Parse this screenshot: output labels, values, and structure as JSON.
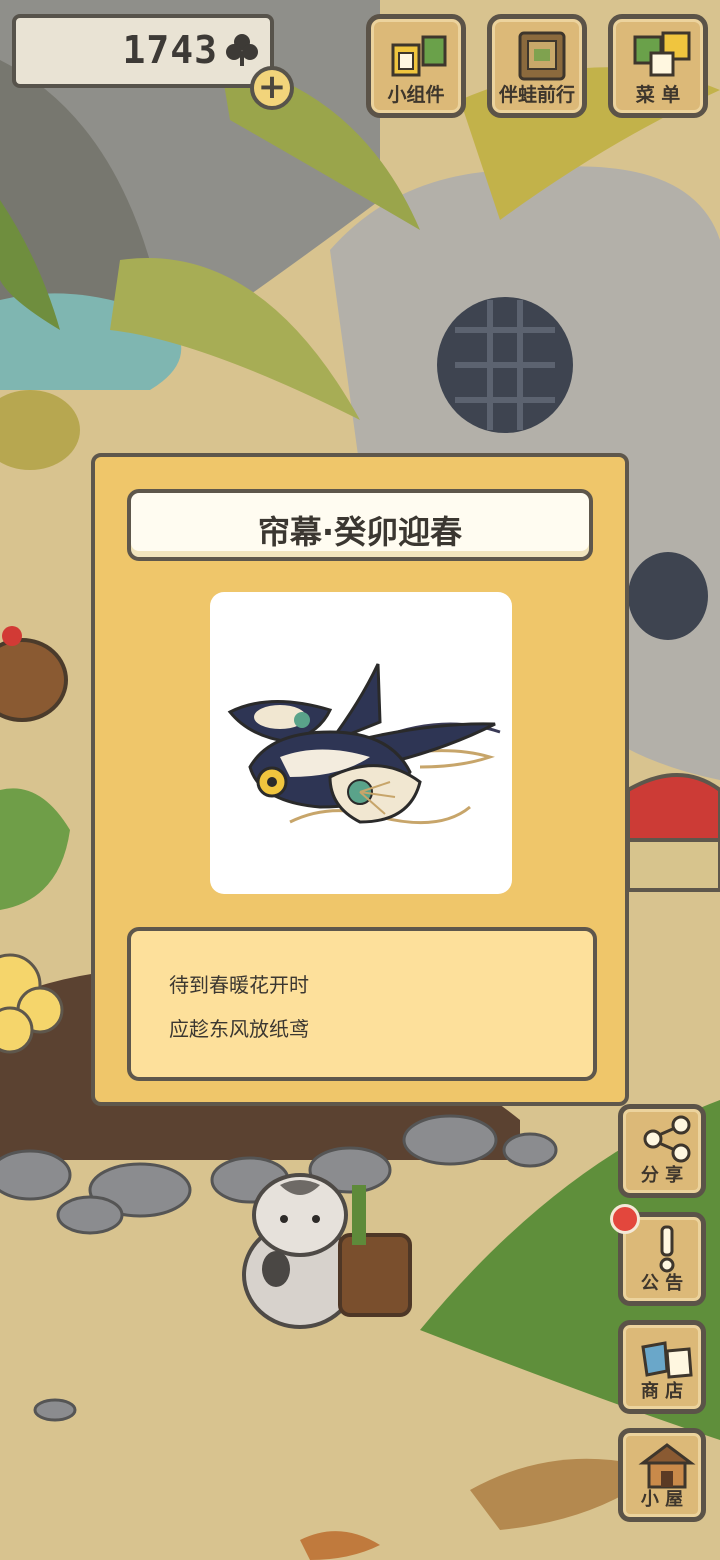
{
  "clover": {
    "count": "1743"
  },
  "top_buttons": {
    "widgets": "小组件",
    "travel": "伴蛙前行",
    "menu": "菜 单"
  },
  "side_buttons": {
    "share": "分 享",
    "notice": "公 告",
    "shop": "商 店",
    "house": "小 屋"
  },
  "dialog": {
    "title": "帘幕·癸卯迎春",
    "description": [
      "待到春暖花开时",
      "应趁东风放纸鸢"
    ]
  },
  "colors": {
    "dialog_bg": "#efc66a",
    "desc_bg": "#fde09b",
    "wood": "#dcb978",
    "outline": "#5e574c",
    "badge": "#e3473d"
  }
}
